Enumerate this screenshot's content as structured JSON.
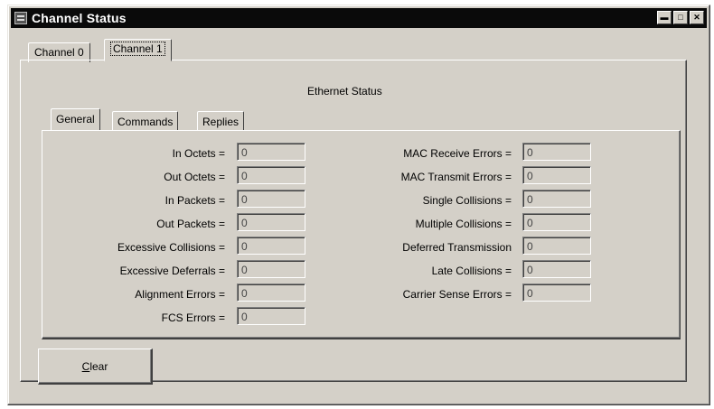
{
  "window": {
    "title": "Channel Status",
    "icon": "window-icon",
    "buttons": [
      "minimize",
      "maximize",
      "close"
    ]
  },
  "outer_tabs": [
    {
      "label": "Channel 0",
      "active": false
    },
    {
      "label": "Channel 1",
      "active": true
    }
  ],
  "section_title": "Ethernet Status",
  "inner_tabs": [
    {
      "label": "General",
      "active": true
    },
    {
      "label": "Commands",
      "active": false
    },
    {
      "label": "Replies",
      "active": false
    }
  ],
  "left_fields": [
    {
      "label": "In Octets =",
      "value": "0"
    },
    {
      "label": "Out Octets =",
      "value": "0"
    },
    {
      "label": "In Packets =",
      "value": "0"
    },
    {
      "label": "Out Packets =",
      "value": "0"
    },
    {
      "label": "Excessive Collisions =",
      "value": "0"
    },
    {
      "label": "Excessive Deferrals =",
      "value": "0"
    },
    {
      "label": "Alignment Errors =",
      "value": "0"
    },
    {
      "label": "FCS Errors =",
      "value": "0"
    }
  ],
  "right_fields": [
    {
      "label": "MAC Receive Errors =",
      "value": "0"
    },
    {
      "label": "MAC Transmit Errors =",
      "value": "0"
    },
    {
      "label": "Single Collisions =",
      "value": "0"
    },
    {
      "label": "Multiple Collisions =",
      "value": "0"
    },
    {
      "label": "Deferred Transmission",
      "value": "0"
    },
    {
      "label": "Late Collisions =",
      "value": "0"
    },
    {
      "label": "Carrier Sense Errors =",
      "value": "0"
    }
  ],
  "clear_button": {
    "label_mnemonic": "C",
    "label_rest": "lear"
  }
}
